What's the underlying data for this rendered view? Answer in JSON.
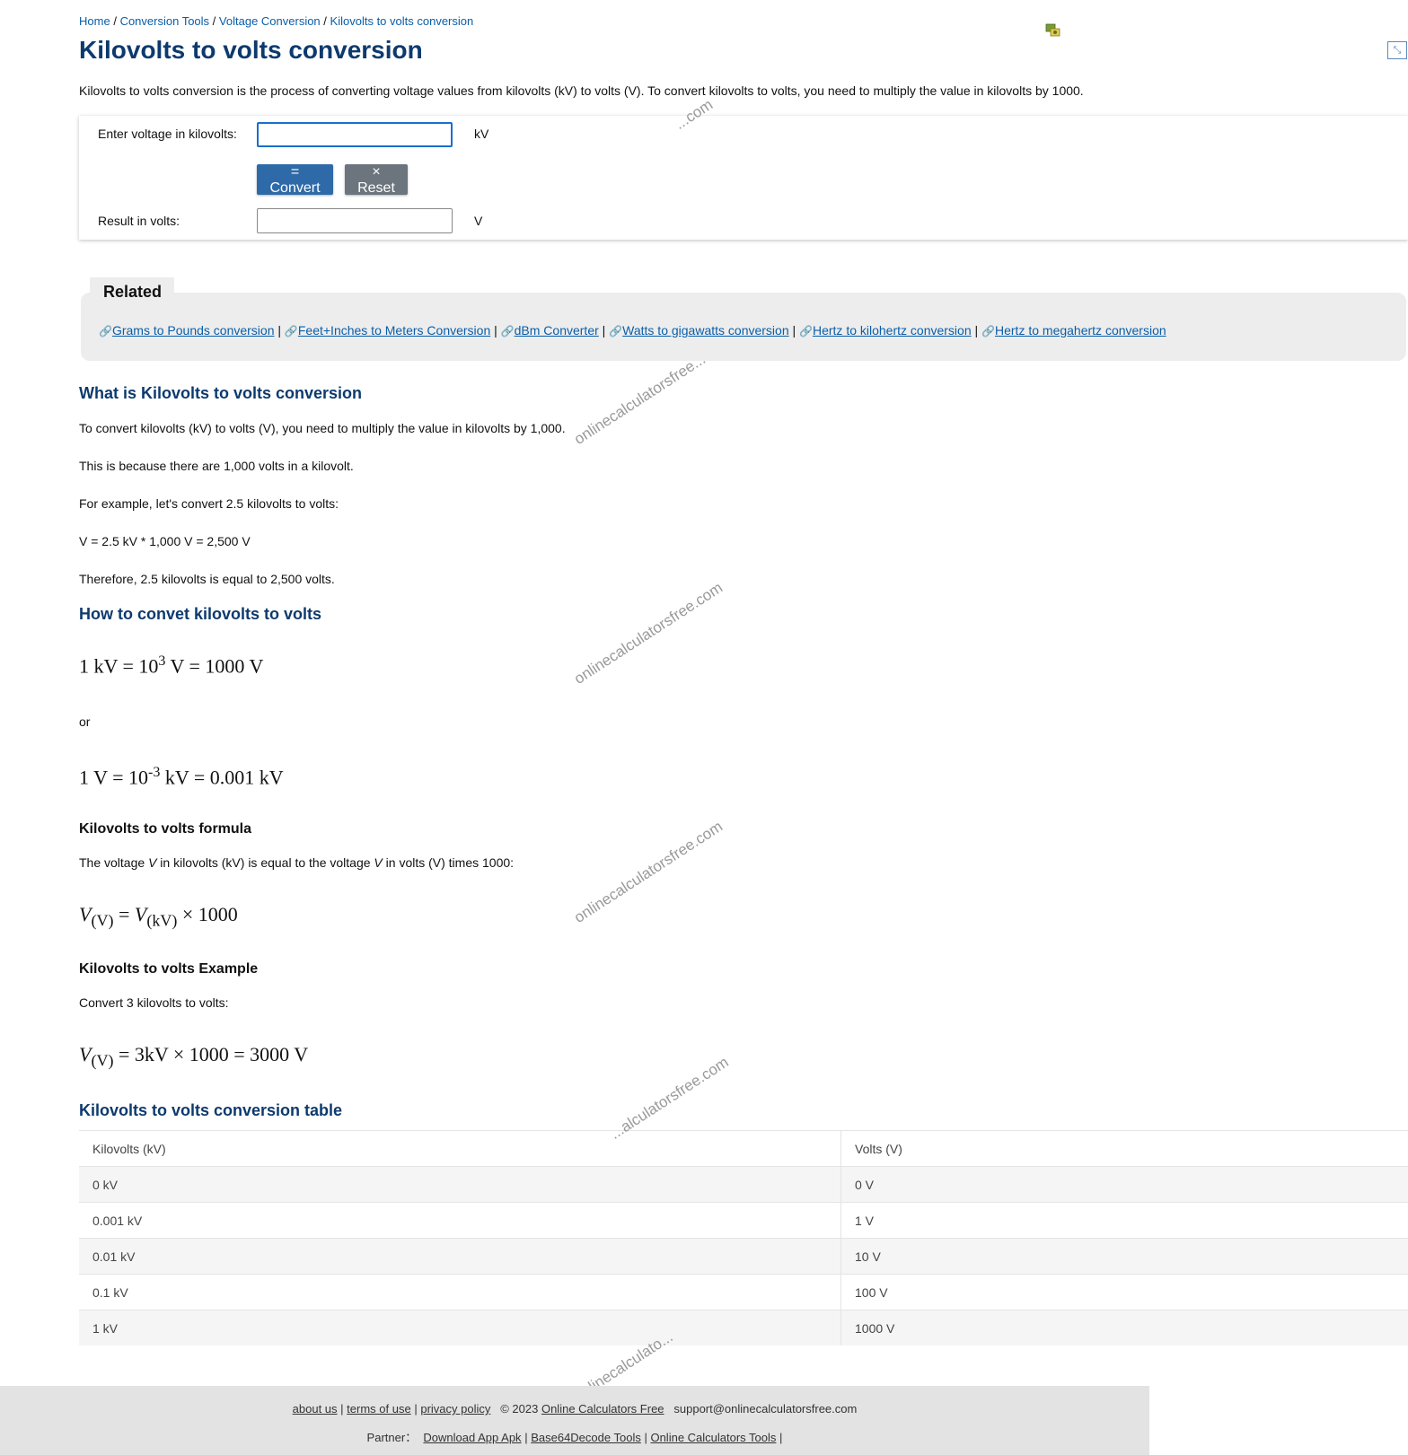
{
  "breadcrumb": {
    "items": [
      "Home",
      "Conversion Tools",
      "Voltage Conversion",
      "Kilovolts to volts conversion"
    ],
    "separator": "/"
  },
  "page_title": "Kilovolts to volts conversion",
  "intro": "Kilovolts to volts conversion is the process of converting voltage values from kilovolts (kV) to volts (V). To convert kilovolts to volts, you need to multiply the value in kilovolts by 1000.",
  "calculator": {
    "input_label": "Enter voltage in kilovolts:",
    "input_value": "",
    "input_unit": "kV",
    "convert_label": "= Convert",
    "reset_label": "× Reset",
    "result_label": "Result in volts:",
    "result_value": "",
    "result_unit": "V"
  },
  "related": {
    "title": "Related",
    "links": [
      "Grams to Pounds conversion",
      "Feet+Inches to Meters Conversion",
      "dBm Converter",
      "Watts to gigawatts conversion",
      "Hertz to kilohertz conversion",
      "Hertz to megahertz conversion"
    ],
    "separator": "|"
  },
  "what_is": {
    "heading": "What is Kilovolts to volts conversion",
    "p1": "To convert kilovolts (kV) to volts (V), you need to multiply the value in kilovolts by 1,000.",
    "p2": "This is because there are 1,000 volts in a kilovolt.",
    "p3": "For example, let's convert 2.5 kilovolts to volts:",
    "p4": "V = 2.5 kV * 1,000 V = 2,500 V",
    "p5": "Therefore, 2.5 kilovolts is equal to 2,500 volts."
  },
  "how_to": {
    "heading": "How to convet kilovolts to volts",
    "eq1_a": "1 kV = 10",
    "eq1_sup": "3",
    "eq1_b": " V = 1000 V",
    "or": "or",
    "eq2_a": "1 V = 10",
    "eq2_sup": "-3",
    "eq2_b": " kV = 0.001 kV"
  },
  "formula": {
    "heading": "Kilovolts to volts formula",
    "text_a": "The voltage ",
    "var1": "V",
    "text_b": " in kilovolts (kV) is equal to the voltage ",
    "var2": "V",
    "text_c": " in volts (V) times 1000:",
    "v1": "V",
    "sub1": "(V)",
    "eq": " = ",
    "v2": "V",
    "sub2": "(kV)",
    "tail": " × 1000"
  },
  "example": {
    "heading": "Kilovolts to volts Example",
    "text": "Convert 3 kilovolts to volts:",
    "v": "V",
    "sub": "(V)",
    "tail": " = 3kV × 1000 = 3000 V"
  },
  "table": {
    "heading": "Kilovolts to volts conversion table",
    "headers": [
      "Kilovolts (kV)",
      "Volts (V)"
    ],
    "rows": [
      [
        "0 kV",
        "0 V"
      ],
      [
        "0.001 kV",
        "1 V"
      ],
      [
        "0.01 kV",
        "10 V"
      ],
      [
        "0.1 kV",
        "100 V"
      ],
      [
        "1 kV",
        "1000 V"
      ]
    ]
  },
  "watermarks": [
    "...com",
    "onlinecalculatorsfree...",
    "onlinecalculatorsfree.com",
    "onlinecalculatorsfree.com",
    "...alculatorsfree.com",
    "...linecalculato..."
  ],
  "footer": {
    "about": "about us",
    "terms": "terms of use",
    "privacy": "privacy policy",
    "copyright": "© 2023",
    "site": "Online Calculators Free",
    "email": "support@onlinecalculatorsfree.com",
    "partner_label": "Partner：",
    "partners": [
      "Download App Apk",
      "Base64Decode Tools",
      "Online Calculators Tools"
    ],
    "separator": "|"
  },
  "colors": {
    "heading": "#0d3a6e",
    "link": "#0a5ea8",
    "convert_button": "#2f6aa8",
    "reset_button": "#6c757d",
    "related_bg": "#ededed",
    "footer_bg": "#e3e3e3"
  },
  "icons": [
    "translate-icon",
    "fullscreen-icon",
    "link-chain-icon"
  ]
}
